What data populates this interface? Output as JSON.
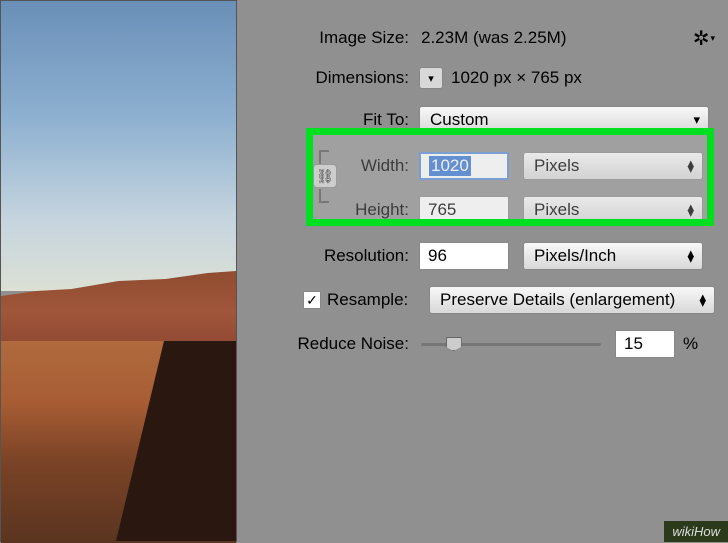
{
  "imageSize": {
    "label": "Image Size:",
    "value": "2.23M (was 2.25M)"
  },
  "dimensions": {
    "label": "Dimensions:",
    "value": "1020 px × 765 px"
  },
  "fitTo": {
    "label": "Fit To:",
    "value": "Custom"
  },
  "width": {
    "label": "Width:",
    "value": "1020",
    "unit": "Pixels"
  },
  "height": {
    "label": "Height:",
    "value": "765",
    "unit": "Pixels"
  },
  "resolution": {
    "label": "Resolution:",
    "value": "96",
    "unit": "Pixels/Inch"
  },
  "resample": {
    "label": "Resample:",
    "value": "Preserve Details (enlargement)"
  },
  "reduceNoise": {
    "label": "Reduce Noise:",
    "value": "15",
    "percent": 15,
    "suffix": "%"
  },
  "watermark": "wikiHow"
}
